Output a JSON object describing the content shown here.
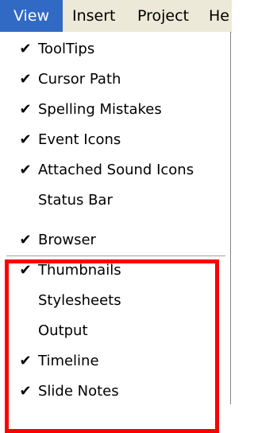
{
  "menubar": {
    "items": [
      {
        "label": "View"
      },
      {
        "label": "Insert"
      },
      {
        "label": "Project"
      },
      {
        "label": "He"
      }
    ]
  },
  "check_glyph": "✔",
  "view_menu": {
    "items": [
      {
        "label": "ToolTips",
        "checked": true
      },
      {
        "label": "Cursor Path",
        "checked": true
      },
      {
        "label": "Spelling Mistakes",
        "checked": true
      },
      {
        "label": "Event Icons",
        "checked": true
      },
      {
        "label": "Attached Sound Icons",
        "checked": true
      },
      {
        "label": "Status Bar",
        "checked": false
      },
      {
        "label": "Browser",
        "checked": true
      },
      {
        "label": "Thumbnails",
        "checked": true
      },
      {
        "label": "Stylesheets",
        "checked": false
      },
      {
        "label": "Output",
        "checked": false
      },
      {
        "label": "Timeline",
        "checked": true
      },
      {
        "label": "Slide Notes",
        "checked": true
      }
    ]
  },
  "colors": {
    "menu_highlight": "#316ac5",
    "annotation_box": "#ff0000"
  }
}
